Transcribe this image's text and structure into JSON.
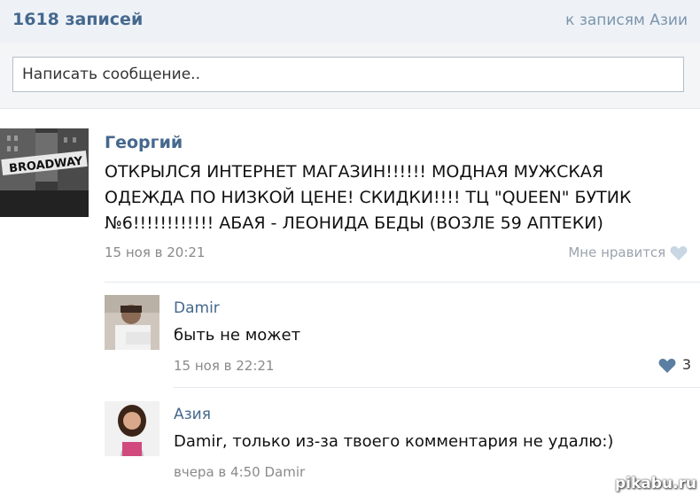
{
  "header": {
    "count": "1618 записей",
    "to_posts_link": "к записям Азии"
  },
  "compose": {
    "placeholder": "Написать сообщение.."
  },
  "post": {
    "author": "Георгий",
    "avatar_text": "BROADWAY",
    "text": "ОТКРЫЛСЯ ИНТЕРНЕТ МАГАЗИН!!!!!! МОДНАЯ МУЖСКАЯ ОДЕЖДА ПО НИЗКОЙ ЦЕНЕ! СКИДКИ!!!! ТЦ \"QUEEN\" БУТИК №6!!!!!!!!!!!! АБАЯ - ЛЕОНИДА БЕДЫ (ВОЗЛЕ 59 АПТЕКИ)",
    "date": "15 ноя в 20:21",
    "like_label": "Мне нравится"
  },
  "comments": [
    {
      "author": "Damir",
      "text": "быть не может",
      "date": "15 ноя в 22:21",
      "likes": "3"
    },
    {
      "author": "Азия",
      "text": "Damir, только из-за твоего комментария не удалю:)",
      "date": "вчера в 4:50 Damir"
    }
  ],
  "watermark": "pikabu.ru",
  "colors": {
    "link": "#45688e",
    "meta": "#8a8a8a",
    "liked_heart": "#5b7ea3",
    "unliked_heart": "#c9d6e3"
  }
}
